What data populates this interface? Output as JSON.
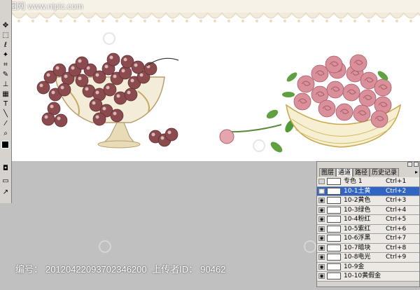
{
  "watermark": "昵图网 www.nipic.com",
  "footer": {
    "id_label": "编号：",
    "id_value": "20120422093702346200",
    "uploader_label": "上传者ID：",
    "uploader_value": "90462"
  },
  "channels_panel": {
    "tabs": [
      "图层",
      "通道",
      "路径",
      "历史记录"
    ],
    "active_tab": "通道",
    "menu_glyph": "▸",
    "rows": [
      {
        "name": "专色 1",
        "shortcut": "Ctrl+1",
        "visible": false,
        "selected": false
      },
      {
        "name": "10-1土黄",
        "shortcut": "Ctrl+2",
        "visible": true,
        "selected": true
      },
      {
        "name": "10-2黄色",
        "shortcut": "Ctrl+3",
        "visible": true,
        "selected": false
      },
      {
        "name": "10-3绿色",
        "shortcut": "Ctrl+4",
        "visible": true,
        "selected": false
      },
      {
        "name": "10-4粉红",
        "shortcut": "Ctrl+5",
        "visible": true,
        "selected": false
      },
      {
        "name": "10-5紫红",
        "shortcut": "Ctrl+6",
        "visible": true,
        "selected": false
      },
      {
        "name": "10-6浮黑",
        "shortcut": "Ctrl+7",
        "visible": true,
        "selected": false
      },
      {
        "name": "10-7暗块",
        "shortcut": "Ctrl+8",
        "visible": true,
        "selected": false
      },
      {
        "name": "10-8电光",
        "shortcut": "Ctrl+9",
        "visible": true,
        "selected": false
      },
      {
        "name": "10-9金",
        "shortcut": "",
        "visible": true,
        "selected": false
      },
      {
        "name": "10-10黄假金",
        "shortcut": "",
        "visible": true,
        "selected": false
      }
    ]
  },
  "toolbox": {
    "tools": [
      "move-icon",
      "marquee-icon",
      "lasso-icon",
      "wand-icon",
      "crop-icon",
      "brush-icon",
      "stamp-icon",
      "eraser-icon",
      "gradient-icon",
      "dodge-icon",
      "pen-icon",
      "text-icon",
      "line-icon",
      "hand-icon",
      "zoom-icon",
      "eyedropper-icon",
      "color-swatch-icon",
      "mask-icon",
      "screen-mode-icon",
      "jump-icon"
    ]
  },
  "colors": {
    "selected_row": "#3165c5",
    "panel_bg": "#d6d3ce",
    "workspace_bg": "#c0c0c0",
    "grape": "#8a4a4e",
    "rose": "#d9909a"
  }
}
